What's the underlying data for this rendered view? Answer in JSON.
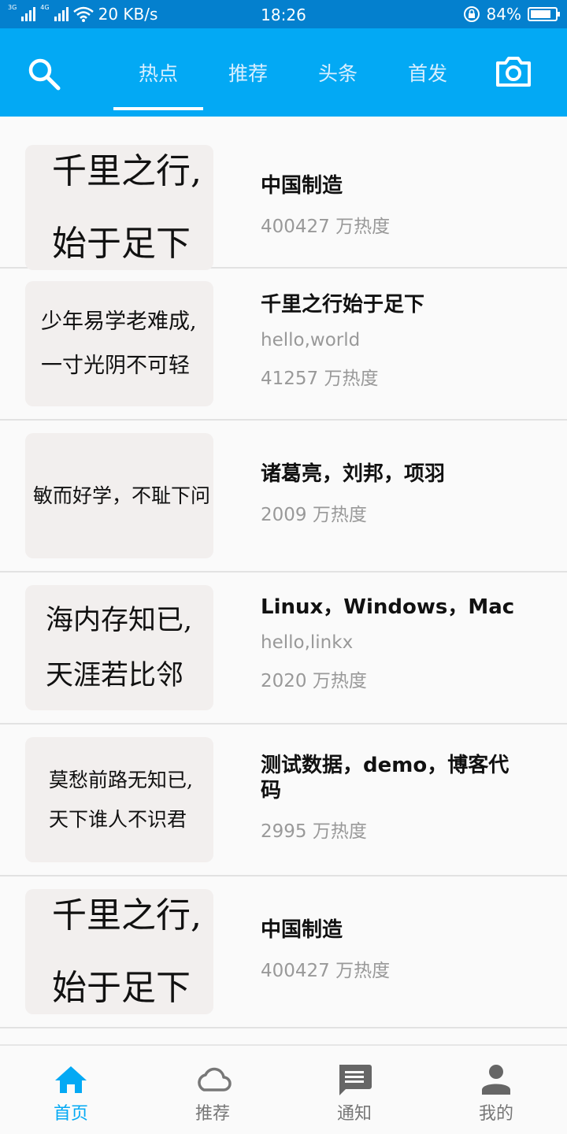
{
  "status_bar": {
    "net1": "3G",
    "net2": "4G",
    "speed": "20 KB/s",
    "time": "18:26",
    "battery_text": "84%",
    "battery_level": 0.84
  },
  "top_bar": {
    "tabs": [
      {
        "label": "热点",
        "active": true
      },
      {
        "label": "推荐",
        "active": false
      },
      {
        "label": "头条",
        "active": false
      },
      {
        "label": "首发",
        "active": false
      }
    ],
    "accent": "#03a9f4"
  },
  "feed": [
    {
      "thumb_lines": [
        "千里之行,",
        "始于足下"
      ],
      "title": "中国制造",
      "subtitle": "",
      "heat": "400427 万热度"
    },
    {
      "thumb_lines": [
        "少年易学老难成,",
        "一寸光阴不可轻"
      ],
      "title": "千里之行始于足下",
      "subtitle": "hello,world",
      "heat": "41257 万热度"
    },
    {
      "thumb_lines": [
        "敏而好学，不耻下问"
      ],
      "title": "诸葛亮，刘邦，项羽",
      "subtitle": "",
      "heat": "2009 万热度"
    },
    {
      "thumb_lines": [
        "海内存知已,",
        "天涯若比邻"
      ],
      "title": "Linux，Windows，Mac",
      "subtitle": "hello,linkx",
      "heat": "2020 万热度"
    },
    {
      "thumb_lines": [
        "莫愁前路无知已,",
        "天下谁人不识君"
      ],
      "title": "测试数据，demo，博客代码",
      "subtitle": "",
      "heat": "2995 万热度"
    },
    {
      "thumb_lines": [
        "千里之行,",
        "始于足下"
      ],
      "title": "中国制造",
      "subtitle": "",
      "heat": "400427 万热度"
    }
  ],
  "bottom_nav": [
    {
      "label": "首页",
      "icon": "home-icon",
      "active": true
    },
    {
      "label": "推荐",
      "icon": "cloud-icon",
      "active": false
    },
    {
      "label": "通知",
      "icon": "message-icon",
      "active": false
    },
    {
      "label": "我的",
      "icon": "person-icon",
      "active": false
    }
  ]
}
